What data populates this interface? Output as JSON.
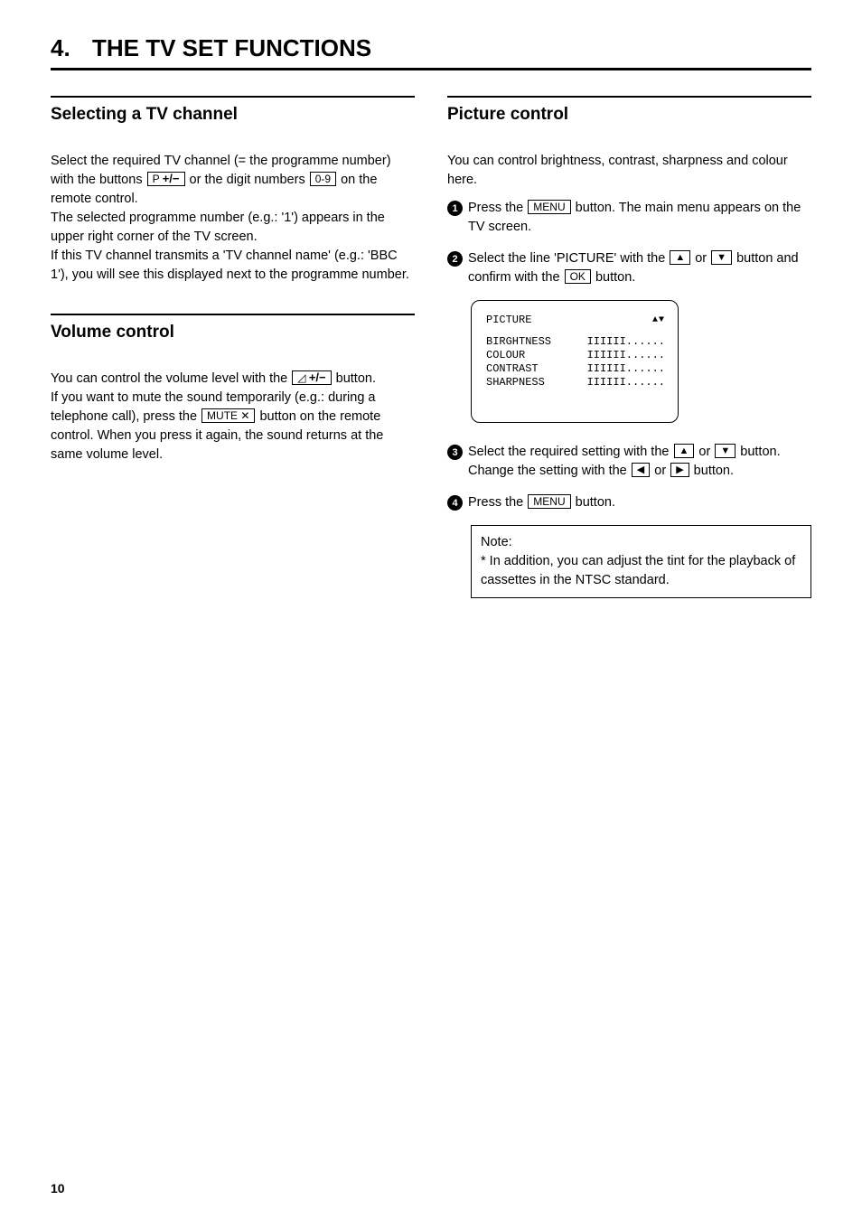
{
  "chapter": {
    "number": "4.",
    "title": "THE TV SET FUNCTIONS"
  },
  "page_number": "10",
  "selecting": {
    "heading": "Selecting a TV channel",
    "line1a": "Select the required TV channel (= the programme number) with the buttons ",
    "line1b": " or the digit numbers ",
    "line1c": " on the remote control.",
    "line2": "The selected programme number (e.g.: '1') appears in the upper right corner of the TV screen.",
    "line3": "If this TV channel transmits a 'TV channel name' (e.g.: 'BBC 1'), you will see this displayed next to the programme number."
  },
  "volume": {
    "heading": "Volume control",
    "line1a": "You can control the volume level with the ",
    "line1b": " button.",
    "line2a": "If you want to mute the sound temporarily (e.g.: during a telephone call), press the ",
    "line2b": " button on the remote control. When you press it again, the sound returns at the same volume level."
  },
  "picture": {
    "heading": "Picture control",
    "intro": "You can control brightness, contrast, sharpness and colour here.",
    "step1a": "Press the ",
    "step1b": " button. The main menu appears on the TV screen.",
    "step2a": "Select the line 'PICTURE' with the ",
    "step2b": " or ",
    "step2c": " button and confirm with the ",
    "step2d": " button.",
    "step3a": "Select the required setting with the ",
    "step3b": " or ",
    "step3c": " button. Change the setting with the ",
    "step3d": " or ",
    "step3e": " button.",
    "step4a": "Press the ",
    "step4b": " button.",
    "note_title": "Note:",
    "note_body": "* In addition, you can adjust the tint for the playback of cassettes in the NTSC standard."
  },
  "osd": {
    "title": "PICTURE",
    "rows": [
      {
        "label": "BIRGHTNESS",
        "bar": "IIIIII......"
      },
      {
        "label": "COLOUR",
        "bar": "IIIIII......"
      },
      {
        "label": "CONTRAST",
        "bar": "IIIIII......"
      },
      {
        "label": "SHARPNESS",
        "bar": "IIIIII......"
      }
    ]
  },
  "keys": {
    "p_plusminus": "P",
    "digits": "0-9",
    "vol": "◿",
    "mute": "MUTE ✕",
    "menu": "MENU",
    "up": "▲",
    "down": "▼",
    "left": "◀",
    "right": "▶",
    "ok": "OK"
  }
}
